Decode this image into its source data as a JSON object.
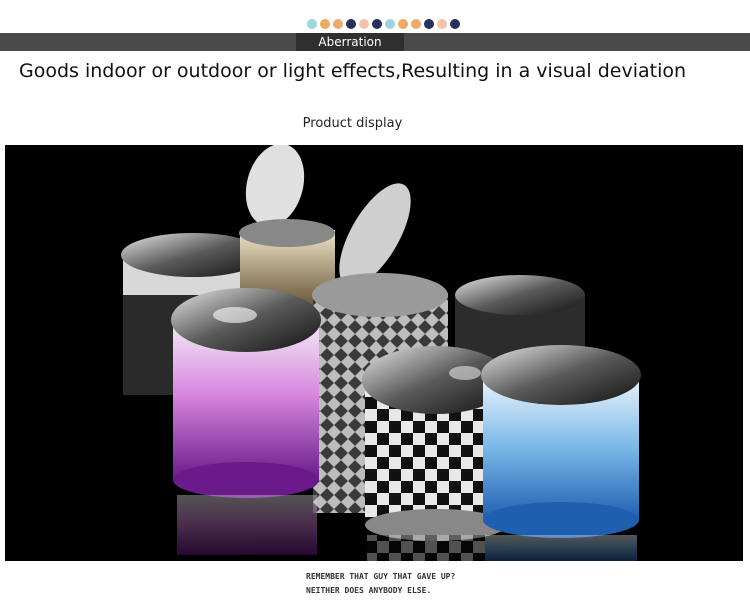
{
  "colors": {
    "dots": [
      "#9ed3e0",
      "#f2a95f",
      "#efa96a",
      "#27305a",
      "#f2c3a8",
      "#27305a",
      "#9ed3e0",
      "#f2a95f",
      "#efa96a",
      "#27305a",
      "#f2c3a8",
      "#27305a"
    ],
    "banner": "#4a4a4a",
    "banner_label_bg": "#2f2f2f"
  },
  "banner": {
    "label": "Aberration"
  },
  "headline": "Goods indoor or outdoor or light effects,Resulting in a visual deviation",
  "subheading": "Product display",
  "footer": {
    "line1": "REMEMBER THAT GUY THAT GAVE UP?",
    "line2": "NEITHER DOES ANYBODY ELSE."
  }
}
